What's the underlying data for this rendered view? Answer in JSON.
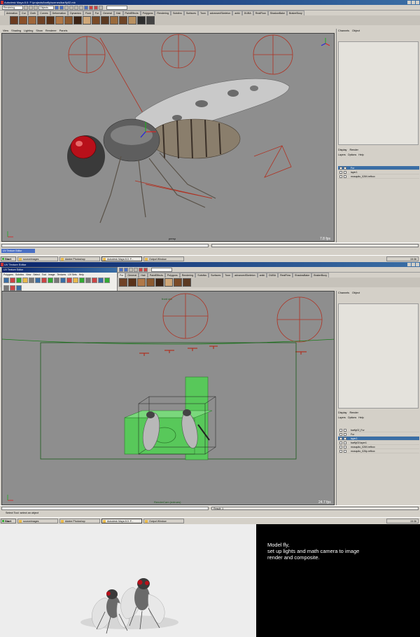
{
  "maya": {
    "title": "Autodesk Maya 8.0: F:/projects/barfly/scenes/barfly02.mb",
    "mode_select": "Rendering",
    "object_select": "Objects",
    "shelf_tabs": [
      "Animation",
      "Cur",
      "Cloth",
      "Curves",
      "Deformation",
      "Dynamics",
      "Fluid",
      "Fur",
      "General",
      "Hair",
      "PaintEffects",
      "Polygons",
      "Rendering",
      "Subdivs",
      "Surfaces",
      "Toon",
      "advancedSkeleton",
      "aniki",
      "DUBA",
      "RealFlow",
      "ShadowBake",
      "BrakerBuoy"
    ],
    "panel_menu": [
      "View",
      "Shading",
      "Lighting",
      "Show",
      "Renderer",
      "Panels"
    ],
    "channel_box": [
      "Channels",
      "Object"
    ],
    "layer_editor": {
      "display": "Display",
      "render": "Render",
      "menus": [
        "Layers",
        "Options",
        "Help"
      ]
    },
    "camera_top": "persp",
    "fps_top": "7.8 fps",
    "layers_top": [
      "Fur",
      "layer1",
      "mosquito_026V.refbox"
    ],
    "camera_bottom": "RenderCam (extrues)",
    "camera_bottom_top": "front orb",
    "fps_bottom": "24.7 fps",
    "layers_bottom": [
      "barfly02_Fur",
      "Fur",
      "layer1",
      "barfly02:layer1",
      "mosquito_026V.refbox",
      "mosquito_026p.refbox"
    ],
    "result_label": "Result: 1",
    "help_line": "Select Tool: select an object"
  },
  "uv_editor": {
    "title": "UV Texture Editor",
    "menus": [
      "Polygons",
      "Subdivs",
      "View",
      "Select",
      "Tool",
      "Image",
      "Textures",
      "UV Sets",
      "Help"
    ]
  },
  "taskbar": {
    "start": "Start",
    "tasks": [
      "sourceimages",
      "Adobe Photoshop",
      "Autodesk Maya 8.0: F...",
      "Output Window"
    ],
    "clock_top": "15:36",
    "clock_bottom": "15:36"
  },
  "caption": {
    "line1": "Model fly,",
    "line2": "set up lights and math camera to image\nrender and composite."
  },
  "colors": {
    "viewport_bg": "#8e8e8e",
    "selected_layer": "#3a6ea5",
    "camera_lines": "#b03020",
    "green_box": "#58c85a"
  }
}
